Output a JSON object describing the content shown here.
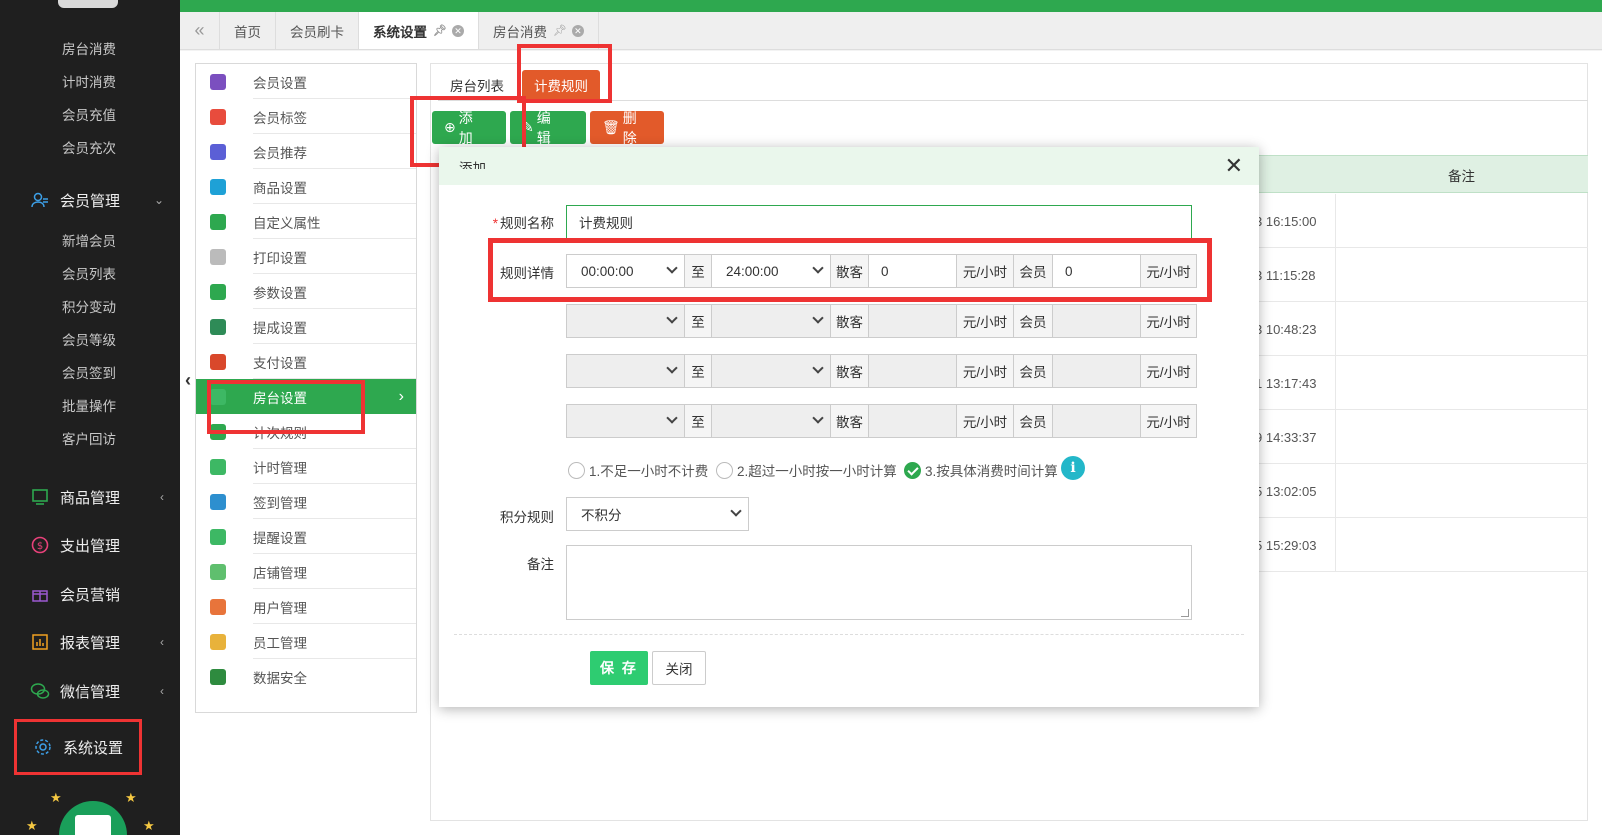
{
  "sidebar": {
    "subitems_top": [
      "房台消费",
      "计时消费",
      "会员充值",
      "会员充次"
    ],
    "member_group": "会员管理",
    "member_items": [
      "新增会员",
      "会员列表",
      "积分变动",
      "会员等级",
      "会员签到",
      "批量操作",
      "客户回访"
    ],
    "groups": [
      {
        "label": "商品管理"
      },
      {
        "label": "支出管理"
      },
      {
        "label": "会员营销"
      },
      {
        "label": "报表管理"
      },
      {
        "label": "微信管理"
      },
      {
        "label": "系统设置"
      }
    ]
  },
  "tabs": [
    "首页",
    "会员刷卡",
    "系统设置",
    "房台消费"
  ],
  "settings_menu": [
    "会员设置",
    "会员标签",
    "会员推荐",
    "商品设置",
    "自定义属性",
    "打印设置",
    "参数设置",
    "提成设置",
    "支付设置",
    "房台设置",
    "计次规则",
    "计时管理",
    "签到管理",
    "提醒设置",
    "店铺管理",
    "用户管理",
    "员工管理",
    "数据安全"
  ],
  "subtabs": [
    "房台列表",
    "计费规则"
  ],
  "toolbar": {
    "add": "添 加",
    "edit": "编 辑",
    "delete": "删 除"
  },
  "grid": {
    "remark_header": "备注",
    "times": [
      "3 16:15:00",
      "3 11:15:28",
      "3 10:48:23",
      "1 13:17:43",
      "9 14:33:37",
      "5 13:02:05",
      "5 15:29:03"
    ]
  },
  "modal": {
    "title": "添加",
    "rule_name_label": "规则名称",
    "rule_name_value": "计费规则",
    "detail_label": "规则详情",
    "to": "至",
    "guest": "散客",
    "member": "会员",
    "unit": "元/小时",
    "row1": {
      "start": "00:00:00",
      "end": "24:00:00",
      "guest_price": "0",
      "member_price": "0"
    },
    "radios": [
      "1.不足一小时不计费",
      "2.超过一小时按一小时计算",
      "3.按具体消费时间计算"
    ],
    "points_label": "积分规则",
    "points_value": "不积分",
    "remark_label": "备注",
    "save": "保 存",
    "close": "关闭"
  },
  "colors": {
    "green": "#2ea84f",
    "orange": "#e25a2a",
    "highlight": "#ee3333",
    "sidebar": "#1f1f1f"
  }
}
